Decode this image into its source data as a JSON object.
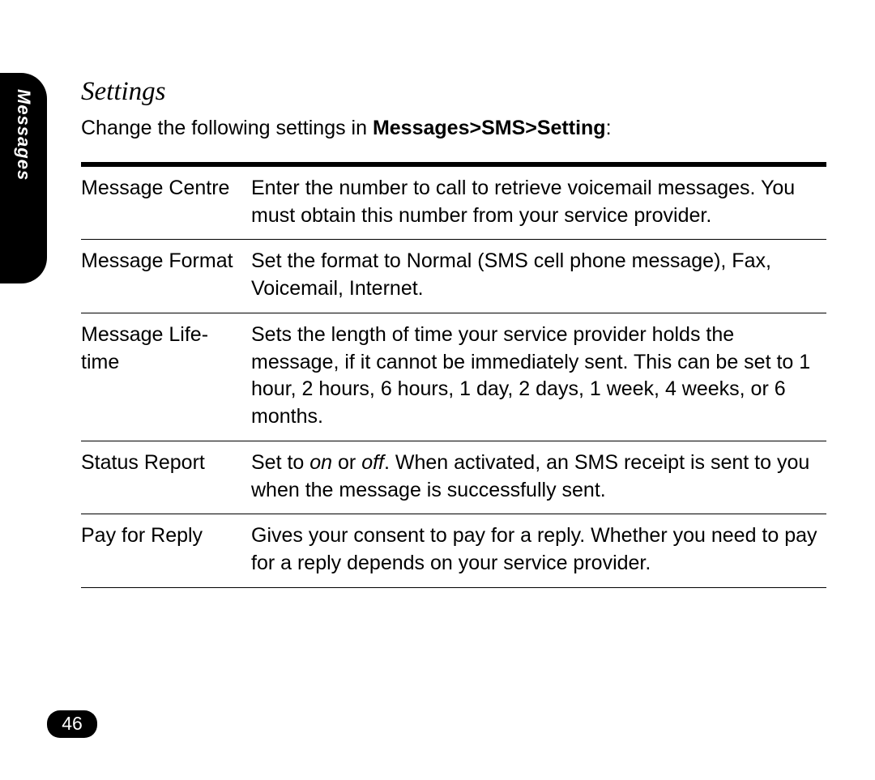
{
  "sideTab": "Messages",
  "sectionTitle": "Settings",
  "intro": {
    "prefix": "Change the following settings in ",
    "path": "Messages>SMS>Setting",
    "suffix": ":"
  },
  "rows": [
    {
      "label": "Message Centre",
      "desc": "Enter the number to call to retrieve voicemail mes­sages. You must obtain this number from your ser­vice provider."
    },
    {
      "label": "Message Format",
      "desc": "Set the format to Normal (SMS cell phone message), Fax, Voicemail, Internet."
    },
    {
      "label": "Message Life­time",
      "desc": "Sets the length of time your service provider holds the message, if it cannot be immediately sent. This can be set to 1 hour, 2 hours, 6 hours, 1 day, 2 days, 1 week, 4 weeks, or 6 months."
    },
    {
      "label": "Status Report",
      "descParts": [
        {
          "t": "Set to "
        },
        {
          "t": "on",
          "ital": true
        },
        {
          "t": " or "
        },
        {
          "t": "off",
          "ital": true
        },
        {
          "t": ". When activated, an SMS receipt is sent to you when the message is successfully sent."
        }
      ]
    },
    {
      "label": "Pay for Reply",
      "desc": "Gives your consent to pay for a reply. Whether you need to pay for a reply depends on your service pro­vider."
    }
  ],
  "pageNumber": "46"
}
